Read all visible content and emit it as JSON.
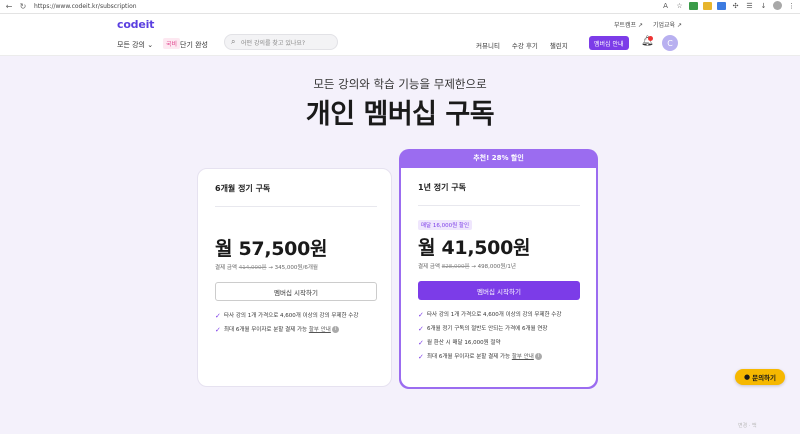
{
  "browser": {
    "url": "https://www.codeit.kr/subscription"
  },
  "header": {
    "logo": "codeit",
    "top_links": [
      "부트캠프 ↗",
      "기업교육 ↗"
    ],
    "all_courses": "모든 강의 ⌄",
    "short_badge": "국비",
    "short_label": "단기 완성",
    "search_placeholder": "어떤 강의를 찾고 있나요?",
    "nav": [
      "커뮤니티",
      "수강 후기",
      "챌린지"
    ],
    "membership_button": "멤버십 안내",
    "avatar_initial": "C"
  },
  "hero": {
    "subtitle": "모든 강의와 학습 기능을 무제한으로",
    "title": "개인 멤버십 구독"
  },
  "plans": {
    "six_month": {
      "title": "6개월 정기 구독",
      "price": "월 57,500원",
      "detail_prefix": "결제 금액 ",
      "detail_original": "414,000원",
      "detail_suffix": " → 345,000원/6개월",
      "button": "멤버십 시작하기",
      "features": [
        "타사 강의 1개 가격으로 4,600개 이상의 강의 무제한 수강",
        "최대 6개월 무이자로 분할 결제 가능 "
      ],
      "feature_link": "할부 안내"
    },
    "one_year": {
      "banner": "추천! 28% 할인",
      "save_badge": "매달 16,000원 할인",
      "title": "1년 정기 구독",
      "price": "월 41,500원",
      "detail_prefix": "결제 금액 ",
      "detail_original": "828,000원",
      "detail_suffix": " → 498,000원/1년",
      "button": "멤버십 시작하기",
      "features": [
        "타사 강의 1개 가격으로 4,600개 이상의 강의 무제한 수강",
        "6개월 정기 구독의 절반도 안되는 가격에 6개월 연장",
        "월 환산 시 매달 16,000원 절약",
        "최대 6개월 무이자로 분할 결제 가능 "
      ],
      "feature_link": "할부 안내"
    }
  },
  "chat_button": "문의하기",
  "watermark": "변경 · 백",
  "colors": {
    "accent": "#7c3ce8",
    "banner": "#9b6cf0",
    "background": "#f4f1fb",
    "chat": "#f6b800"
  }
}
